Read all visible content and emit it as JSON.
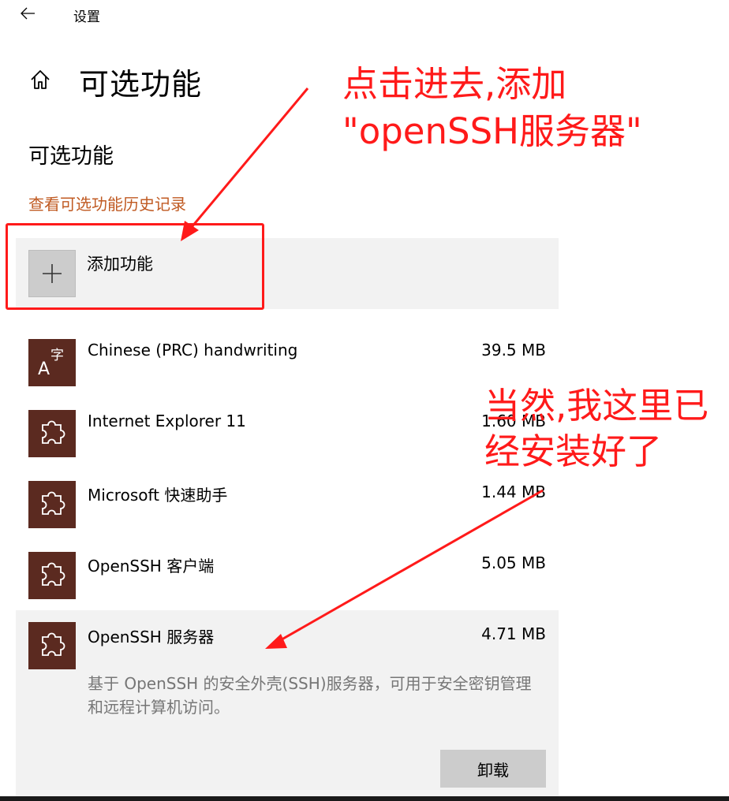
{
  "window": {
    "title": "设置"
  },
  "header": {
    "page_title": "可选功能"
  },
  "section": {
    "title": "可选功能",
    "history_link": "查看可选功能历史记录"
  },
  "add_feature": {
    "label": "添加功能"
  },
  "features": [
    {
      "name": "Chinese (PRC) handwriting",
      "size": "39.5 MB",
      "icon": "language-handwriting-icon",
      "icon_glyph_main": "A",
      "icon_glyph_sup": "字"
    },
    {
      "name": "Internet Explorer 11",
      "size": "1.60 MB",
      "icon": "puzzle-piece-icon"
    },
    {
      "name": "Microsoft 快速助手",
      "size": "1.44 MB",
      "icon": "puzzle-piece-icon"
    },
    {
      "name": "OpenSSH 客户端",
      "size": "5.05 MB",
      "icon": "puzzle-piece-icon"
    },
    {
      "name": "OpenSSH 服务器",
      "size": "4.71 MB",
      "icon": "puzzle-piece-icon",
      "description": "基于 OpenSSH 的安全外壳(SSH)服务器，可用于安全密钥管理和远程计算机访问。",
      "uninstall_label": "卸载"
    }
  ],
  "annotations": {
    "top_line1": "点击进去,添加",
    "top_line2": "\"openSSH服务器\"",
    "right_line1": "当然,我这里已",
    "right_line2": "经安装好了"
  },
  "colors": {
    "accent_link": "#c05a22",
    "feature_icon_bg": "#5b2a20",
    "annotation": "#ff1a1a",
    "selected_bg": "#f2f2f2"
  }
}
